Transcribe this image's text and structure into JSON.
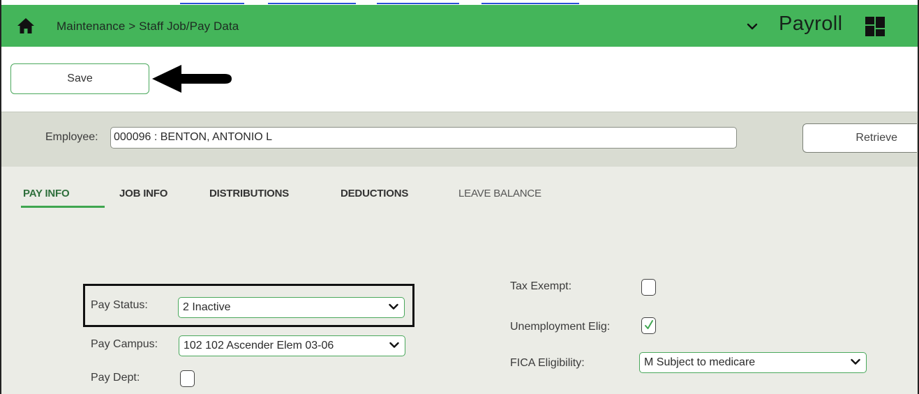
{
  "header": {
    "breadcrumb": "Maintenance > Staff Job/Pay Data",
    "module_name": "Payroll",
    "bar_color": "#44b55a",
    "icons": [
      "home-icon",
      "chevron-down-icon",
      "grid-icon"
    ]
  },
  "toolbar": {
    "save_label": "Save"
  },
  "employee": {
    "label": "Employee:",
    "value": "000096 : BENTON, ANTONIO L",
    "retrieve_label": "Retrieve"
  },
  "tabs": [
    {
      "label": "PAY INFO",
      "active": true
    },
    {
      "label": "JOB INFO",
      "active": false
    },
    {
      "label": "DISTRIBUTIONS",
      "active": false
    },
    {
      "label": "DEDUCTIONS",
      "active": false
    },
    {
      "label": "LEAVE BALANCE",
      "active": false
    }
  ],
  "pay_info": {
    "pay_status": {
      "label": "Pay Status:",
      "value": "2 Inactive"
    },
    "pay_campus": {
      "label": "Pay Campus:",
      "value": "102 102 Ascender Elem 03-06"
    },
    "pay_dept": {
      "label": "Pay Dept:",
      "checked": false
    },
    "tax_exempt": {
      "label": "Tax Exempt:",
      "checked": false
    },
    "unemployment_elig": {
      "label": "Unemployment Elig:",
      "checked": true
    },
    "fica_eligibility": {
      "label": "FICA Eligibility:",
      "value": "M Subject to medicare"
    }
  },
  "colors": {
    "accent_green": "#3fa650",
    "active_tab_text": "#2f6f3c",
    "panel_background": "#ebece6",
    "employee_band": "#d9dcd2"
  }
}
